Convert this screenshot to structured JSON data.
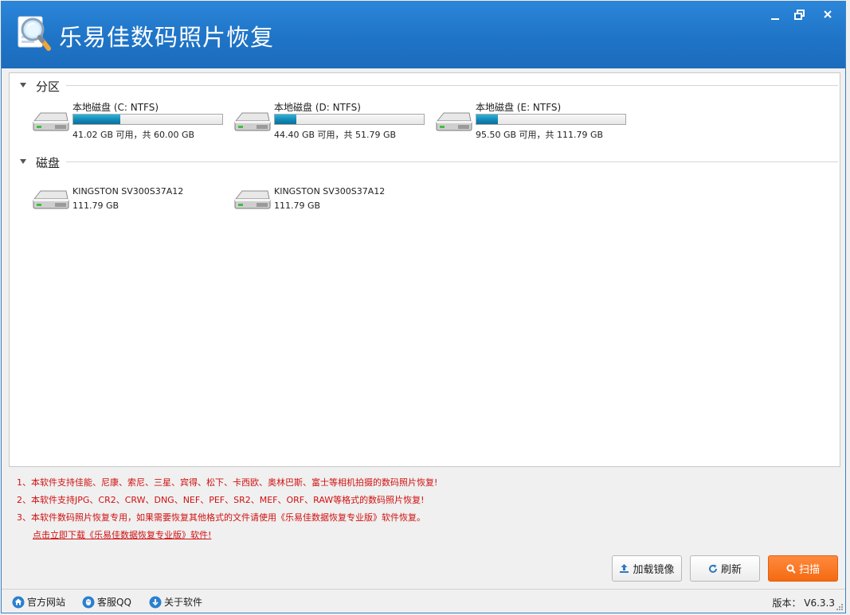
{
  "app": {
    "title": "乐易佳数码照片恢复",
    "logo_icon": "magnifier-photo-logo",
    "accent": "#1f74c7"
  },
  "window_controls": {
    "minimize": "minimize-icon",
    "restore": "restore-icon",
    "close": "close-icon"
  },
  "partitions": {
    "title": "分区",
    "items": [
      {
        "name": "本地磁盘 (C: NTFS)",
        "info": "41.02 GB 可用，共 60.00 GB",
        "used_fraction": 0.316
      },
      {
        "name": "本地磁盘 (D: NTFS)",
        "info": "44.40 GB 可用，共 51.79 GB",
        "used_fraction": 0.143
      },
      {
        "name": "本地磁盘 (E: NTFS)",
        "info": "95.50 GB 可用，共 111.79 GB",
        "used_fraction": 0.146
      }
    ]
  },
  "disks": {
    "title": "磁盘",
    "items": [
      {
        "name": "KINGSTON  SV300S37A12",
        "size": "111.79 GB"
      },
      {
        "name": "KINGSTON  SV300S37A12",
        "size": "111.79 GB"
      }
    ]
  },
  "notes": [
    "1、本软件支持佳能、尼康、索尼、三星、宾得、松下、卡西欧、奥林巴斯、富士等相机拍摄的数码照片恢复!",
    "2、本软件支持JPG、CR2、CRW、DNG、NEF、PEF、SR2、MEF、ORF、RAW等格式的数码照片恢复!",
    "3、本软件数码照片恢复专用，如果需要恢复其他格式的文件请使用《乐易佳数据恢复专业版》软件恢复。"
  ],
  "download_link": "点击立即下载《乐易佳数据恢复专业版》软件!",
  "buttons": {
    "load_image": "加载镜像",
    "refresh": "刷新",
    "scan": "扫描"
  },
  "status": {
    "website": "官方网站",
    "qq": "客服QQ",
    "about": "关于软件",
    "version": "版本： V6.3.3"
  },
  "colors": {
    "note_red": "#d01010",
    "scan_orange": "#f46a12",
    "bar_blue": "#1288b6"
  }
}
